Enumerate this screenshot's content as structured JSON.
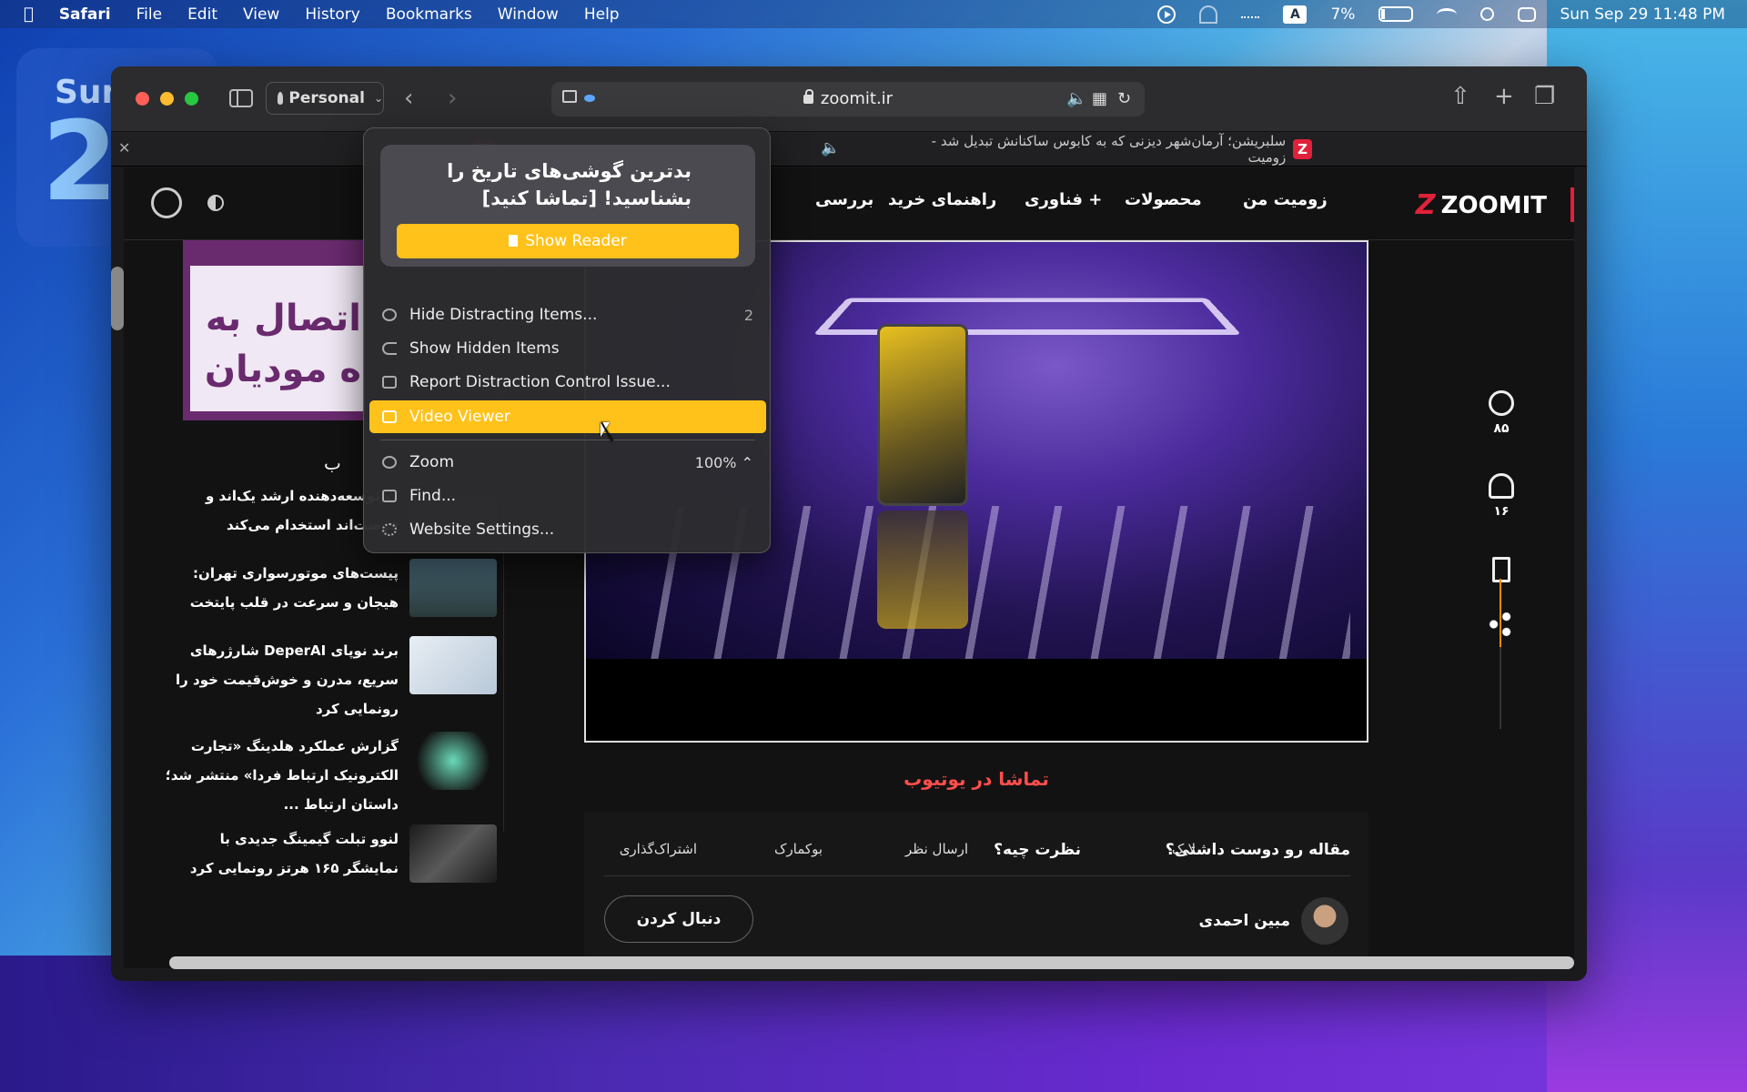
{
  "menubar": {
    "apple": "",
    "app": "Safari",
    "items": [
      "File",
      "Edit",
      "View",
      "History",
      "Bookmarks",
      "Window",
      "Help"
    ],
    "input_source": "A",
    "battery": "7%",
    "datetime": "Sun Sep 29  11:48 PM"
  },
  "widget": {
    "day": "Sun",
    "date": "2"
  },
  "browser": {
    "profile": "Personal",
    "url": "zoomit.ir",
    "tabs": [
      {
        "title": "سلبریشن؛ آرمان‌شهر دیزنی که به کابوس ساکنانش تبدیل شد - زومیت",
        "favicon": "Z"
      },
      {
        "title": "یت",
        "favicon": "Z"
      }
    ]
  },
  "site": {
    "logo": "ZOOMIT",
    "nav": [
      "زومیت من",
      "محصولات",
      "+ فناوری",
      "راهنمای خرید",
      "بررسی"
    ],
    "ad_text": "اتصال به\nه مودیان",
    "side_heading": "ب",
    "news": [
      {
        "title": "ت توسعه‌دهنده ارشد یک‌اند و فرصت‌اند استخدام می‌کند"
      },
      {
        "title": "پیست‌های موتورسواری تهران: هیجان و سرعت در قلب پایتخت"
      },
      {
        "title": "برند نوپای DeperAI شارژرهای سریع، مدرن و خوش‌قیمت خود را رونمایی کرد"
      },
      {
        "title": "گزارش عملکرد هلدینگ «تجارت الکترونیک ارتباط فردا» منتشر شد؛ داستان ارتباط ..."
      },
      {
        "title": "لنوو تبلت گیمینگ جدیدی با نمایشگر ۱۶۵ هرتز رونمایی کرد"
      }
    ],
    "watch_youtube": "تماشا در یوتیوب",
    "rail": {
      "comments": "۸۵",
      "likes": "۱۶"
    },
    "footer": {
      "liked_q": "مقاله رو دوست داشتی؟",
      "like": "لایک",
      "opinion_q": "نظرت چیه؟",
      "send_comment": "ارسال نظر",
      "bookmark": "بوکمارک",
      "share": "اشتراک‌گذاری",
      "author": "مبین احمدی",
      "follow": "دنبال کردن"
    }
  },
  "popup": {
    "reader_title": "بدترین گوشی‌های تاریخ را بشناسید! [تماشا کنید]",
    "show_reader": "Show Reader",
    "items": [
      {
        "label": "Hide Distracting Items...",
        "extra": "2"
      },
      {
        "label": "Show Hidden Items",
        "extra": ""
      },
      {
        "label": "Report Distraction Control Issue...",
        "extra": ""
      },
      {
        "label": "Video Viewer",
        "extra": ""
      },
      {
        "label": "Zoom",
        "extra": "100% ⌃"
      },
      {
        "label": "Find...",
        "extra": ""
      },
      {
        "label": "Website Settings...",
        "extra": ""
      }
    ]
  },
  "colors": {
    "accent": "#ffc21a",
    "brand": "#e0213a",
    "youtube_link": "#ff4d4d"
  }
}
